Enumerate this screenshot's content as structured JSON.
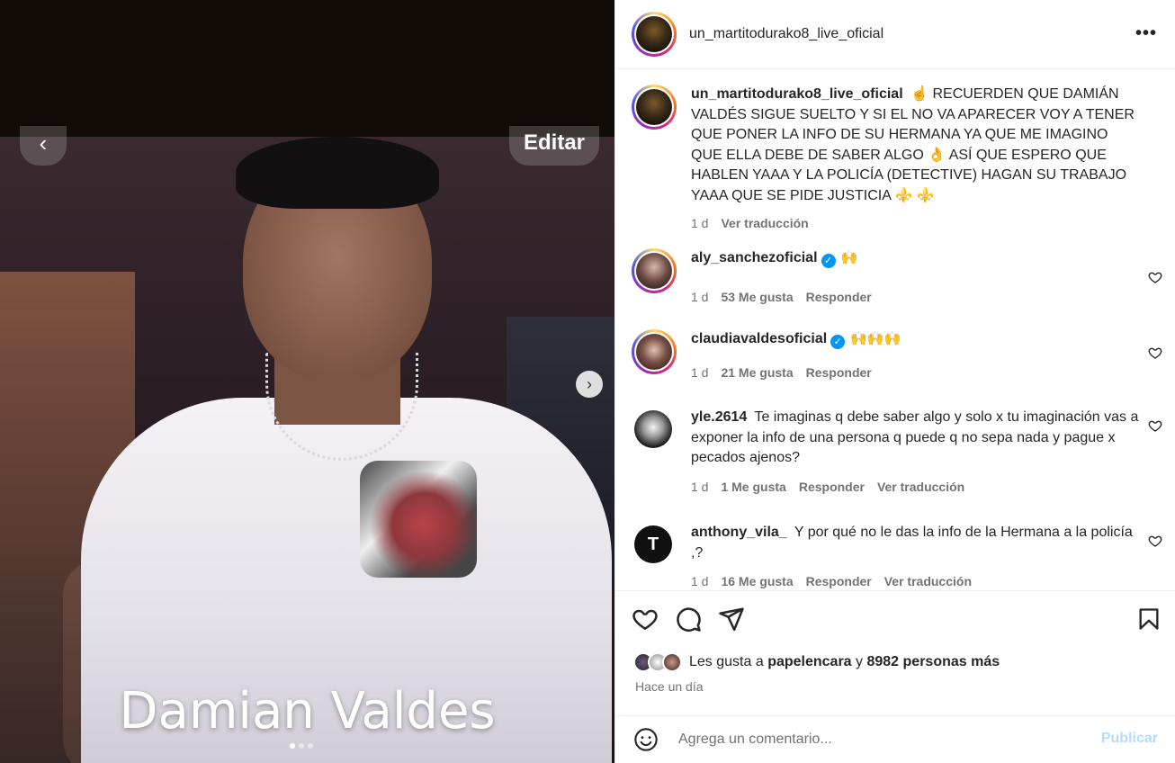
{
  "post": {
    "image_caption": "Damian Valdes",
    "back_icon": "chevron-left-icon",
    "edit_label": "Editar",
    "carousel_count": 3,
    "carousel_index": 1
  },
  "header": {
    "username": "un_martitodurako8_live_oficial",
    "more_label": "•••"
  },
  "caption": {
    "username": "un_martitodurako8_live_oficial",
    "text": "☝️ RECUERDEN QUE DAMIÁN VALDÉS SIGUE SUELTO Y SI EL NO VA APARECER VOY A TENER QUE PONER LA INFO DE SU HERMANA YA QUE ME IMAGINO QUE ELLA DEBE DE SABER ALGO 👌 ASÍ QUE ESPERO QUE HABLEN YAAA Y LA POLICÍA (DETECTIVE) HAGAN SU TRABAJO YAAA QUE SE PIDE JUSTICIA ⚜️ ⚜️",
    "time": "1 d",
    "translate": "Ver traducción"
  },
  "comments": [
    {
      "username": "aly_sanchezoficial",
      "verified": true,
      "text": "🙌",
      "time": "1 d",
      "likes": "53 Me gusta",
      "reply": "Responder",
      "translate": ""
    },
    {
      "username": "claudiavaldesoficial",
      "verified": true,
      "text": "🙌🙌🙌",
      "time": "1 d",
      "likes": "21 Me gusta",
      "reply": "Responder",
      "translate": ""
    },
    {
      "username": "yle.2614",
      "verified": false,
      "text": "Te imaginas q debe saber algo y solo x tu imaginación vas a exponer la info de una persona q puede q no sepa nada y pague x pecados ajenos?",
      "time": "1 d",
      "likes": "1 Me gusta",
      "reply": "Responder",
      "translate": "Ver traducción"
    },
    {
      "username": "anthony_vila_",
      "verified": false,
      "text": "Y por qué no le das la info de la Hermana a la policía ,?",
      "time": "1 d",
      "likes": "16 Me gusta",
      "reply": "Responder",
      "translate": "Ver traducción"
    }
  ],
  "actions": {
    "like_icon": "heart-icon",
    "comment_icon": "comment-icon",
    "share_icon": "share-icon",
    "save_icon": "bookmark-icon"
  },
  "likes": {
    "prefix": "Les gusta a",
    "user": "papelencara",
    "conjunction": "y",
    "others": "8982 personas más"
  },
  "posted": "Hace un día",
  "add_comment": {
    "placeholder": "Agrega un comentario...",
    "publish": "Publicar",
    "emoji_icon": "emoji-icon"
  },
  "colors": {
    "accent": "#0095f6",
    "publish_disabled": "#b3dbff",
    "muted_text": "#737373"
  }
}
